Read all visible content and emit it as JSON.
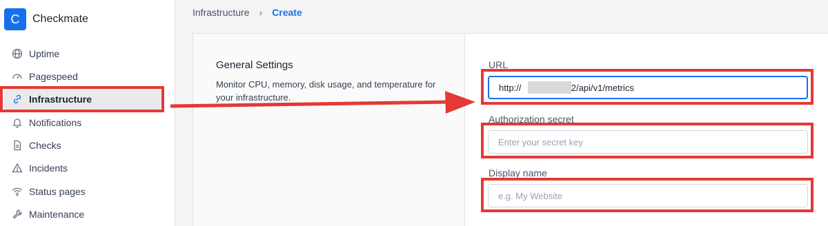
{
  "app": {
    "logo_letter": "C",
    "name": "Checkmate"
  },
  "sidebar": {
    "items": [
      {
        "label": "Uptime",
        "icon": "globe-icon"
      },
      {
        "label": "Pagespeed",
        "icon": "gauge-icon"
      },
      {
        "label": "Infrastructure",
        "icon": "link-icon",
        "active": true
      },
      {
        "label": "Notifications",
        "icon": "bell-icon"
      },
      {
        "label": "Checks",
        "icon": "document-icon"
      },
      {
        "label": "Incidents",
        "icon": "warning-icon"
      },
      {
        "label": "Status pages",
        "icon": "wifi-icon"
      },
      {
        "label": "Maintenance",
        "icon": "wrench-icon"
      }
    ]
  },
  "breadcrumb": {
    "parent": "Infrastructure",
    "current": "Create"
  },
  "general": {
    "title": "General Settings",
    "description": "Monitor CPU, memory, disk usage, and temperature for your infrastructure."
  },
  "form": {
    "url": {
      "label": "URL",
      "value": "http://            59232/api/v1/metrics"
    },
    "secret": {
      "label": "Authorization secret",
      "placeholder": "Enter your secret key"
    },
    "display_name": {
      "label": "Display name",
      "placeholder": "e.g. My Website"
    }
  },
  "colors": {
    "accent": "#1570ef",
    "annotation": "#e53935"
  }
}
